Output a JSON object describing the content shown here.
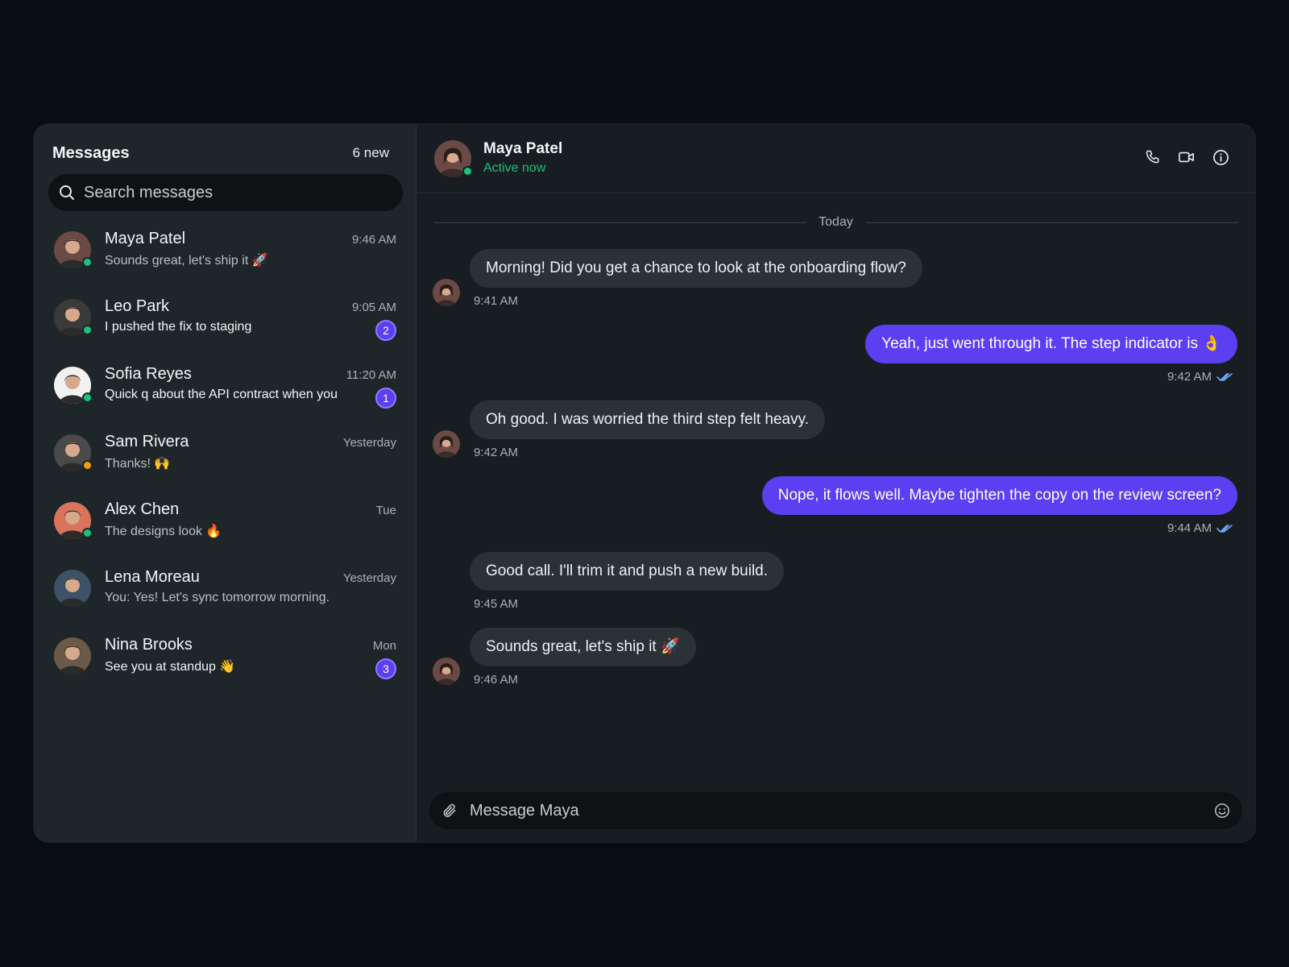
{
  "sidebar": {
    "title": "Messages",
    "new_count": "6 new",
    "search_placeholder": "Search messages",
    "conversations": [
      {
        "name": "Maya Patel",
        "time": "9:46 AM",
        "preview": "Sounds great, let's ship it 🚀",
        "unread": "",
        "status": "online",
        "avatar_bg": "#6b4a45"
      },
      {
        "name": "Leo Park",
        "time": "9:05 AM",
        "preview": "I pushed the fix to staging",
        "unread": "2",
        "status": "online",
        "avatar_bg": "#3a3a3a"
      },
      {
        "name": "Sofia Reyes",
        "time": "11:20 AM",
        "preview": "Quick q about the API contract when you",
        "unread": "1",
        "status": "online",
        "avatar_bg": "#f2f2f2"
      },
      {
        "name": "Sam Rivera",
        "time": "Yesterday",
        "preview": "Thanks! 🙌",
        "unread": "",
        "status": "away",
        "avatar_bg": "#4a4a4a"
      },
      {
        "name": "Alex Chen",
        "time": "Tue",
        "preview": "The designs look 🔥",
        "unread": "",
        "status": "online",
        "avatar_bg": "#d9735a"
      },
      {
        "name": "Lena Moreau",
        "time": "Yesterday",
        "preview": "You: Yes! Let's sync tomorrow morning.",
        "unread": "",
        "status": "none",
        "avatar_bg": "#3d5266"
      },
      {
        "name": "Nina Brooks",
        "time": "Mon",
        "preview": "See you at standup 👋",
        "unread": "3",
        "status": "none",
        "avatar_bg": "#6b5a4a"
      }
    ]
  },
  "chat": {
    "contact_name": "Maya Patel",
    "contact_status": "Active now",
    "day_divider": "Today",
    "messages": [
      {
        "direction": "in",
        "text": "Morning! Did you get a chance to look at the onboarding flow?",
        "time": "9:41 AM"
      },
      {
        "direction": "out",
        "text": "Yeah, just went through it. The step indicator is 👌",
        "time": "9:42 AM"
      },
      {
        "direction": "in",
        "text": "Oh good. I was worried the third step felt heavy.",
        "time": "9:42 AM"
      },
      {
        "direction": "out",
        "text": "Nope, it flows well. Maybe tighten the copy on the review screen?",
        "time": "9:44 AM"
      },
      {
        "direction": "in",
        "text": "Good call. I'll trim it and push a new build.",
        "time": "9:45 AM"
      },
      {
        "direction": "in",
        "text": "Sounds great, let's ship it 🚀",
        "time": "9:46 AM"
      }
    ],
    "composer_placeholder": "Message Maya"
  },
  "colors": {
    "accent": "#5b3ff0",
    "online": "#19c37d",
    "away": "#f59e0b",
    "read_receipt": "#6ea8ff"
  },
  "icons": [
    "search-icon",
    "phone-icon",
    "video-icon",
    "info-icon",
    "paperclip-icon",
    "emoji-icon",
    "double-check-icon"
  ]
}
